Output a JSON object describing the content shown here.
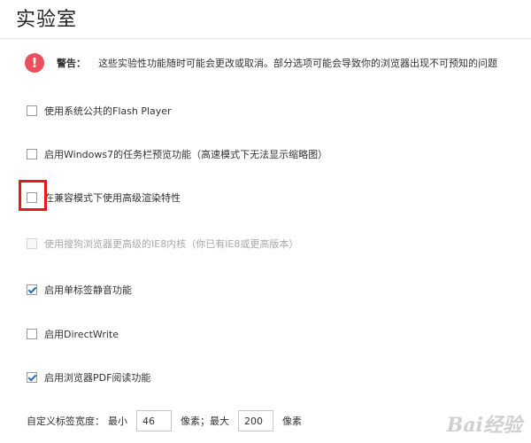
{
  "page": {
    "title": "实验室"
  },
  "warning": {
    "icon": "exclamation-icon",
    "icon_glyph": "!",
    "label": "警告：",
    "text": "这些实验性功能随时可能会更改或取消。部分选项可能会导致你的浏览器出现不可预知的问题"
  },
  "options": [
    {
      "label": "使用系统公共的Flash Player",
      "checked": false,
      "disabled": false
    },
    {
      "label": "启用Windows7的任务栏预览功能（高速模式下无法显示缩略图）",
      "checked": false,
      "disabled": false
    },
    {
      "label": "在兼容模式下使用高级渲染特性",
      "checked": false,
      "disabled": false
    },
    {
      "label": "使用搜狗浏览器更高级的IE8内核（你已有IE8或更高版本）",
      "checked": false,
      "disabled": true
    },
    {
      "label": "启用单标签静音功能",
      "checked": true,
      "disabled": false
    },
    {
      "label": "启用DirectWrite",
      "checked": false,
      "disabled": false
    },
    {
      "label": "启用浏览器PDF阅读功能",
      "checked": true,
      "disabled": false
    }
  ],
  "tab_width": {
    "label": "自定义标签宽度：",
    "min_label": "最小",
    "min_value": "46",
    "unit_min": "像素；最大",
    "max_value": "200",
    "unit_max": "像素"
  },
  "watermark": {
    "text": "Bai经验"
  },
  "colors": {
    "warning_icon": "#e8505b",
    "highlight": "#e21c1c",
    "checkmark": "#2d6db5"
  }
}
